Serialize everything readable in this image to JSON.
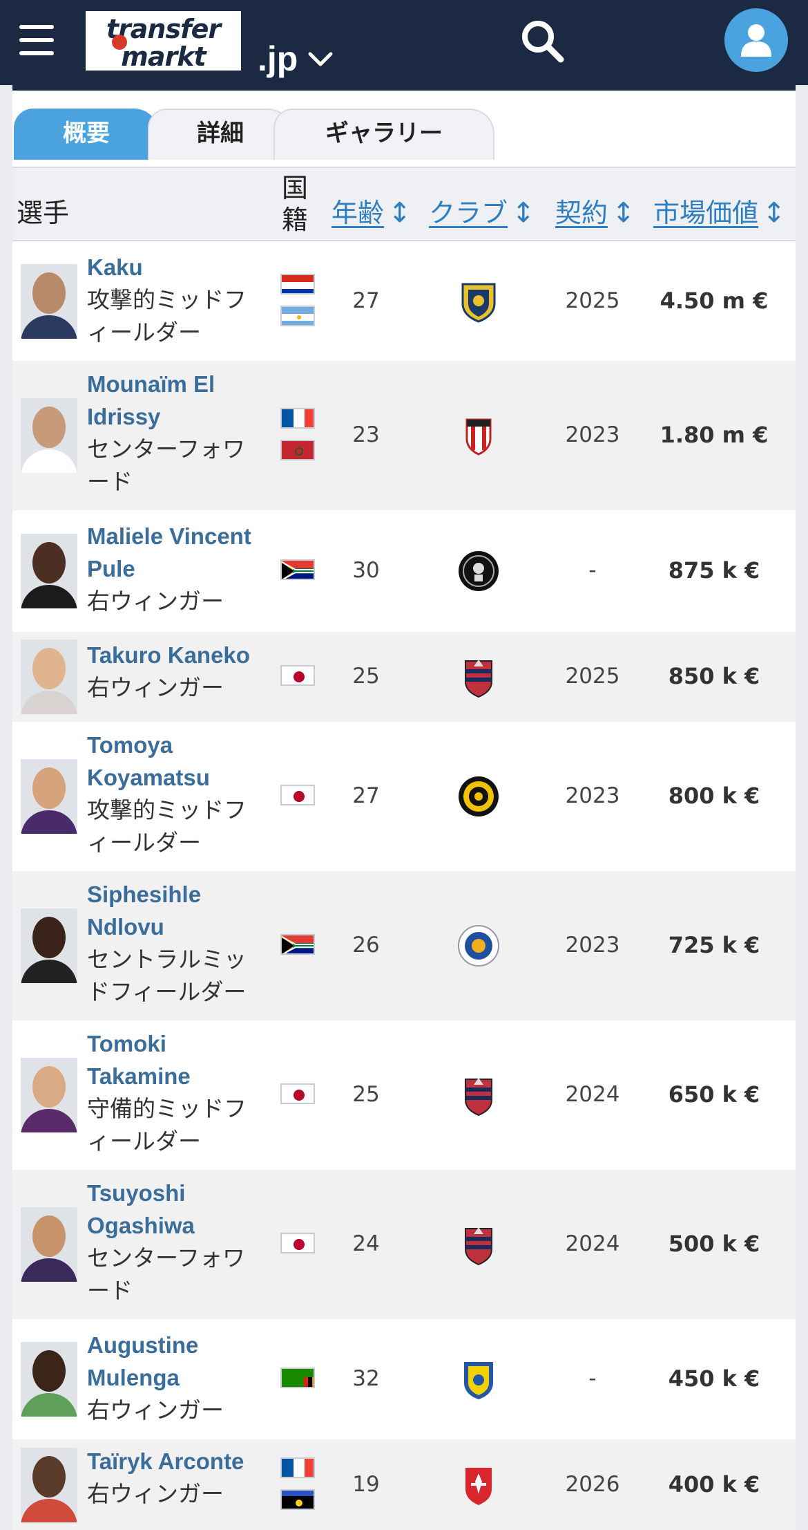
{
  "header": {
    "logo_top": "transfer",
    "logo_bottom": "markt",
    "tld": ".jp"
  },
  "tabs": [
    "概要",
    "詳細",
    "ギャラリー"
  ],
  "table": {
    "columns": {
      "player": "選手",
      "nationality": "国籍",
      "age": "年齢",
      "club": "クラブ",
      "contract": "契約",
      "market_value": "市場価値",
      "sort_glyph": "↕"
    },
    "rows": [
      {
        "name": "Kaku",
        "position": "攻撃的ミッドフィールダー",
        "flags": [
          "paraguay",
          "argentina"
        ],
        "age": "27",
        "club_icon": "crest-shield-yellow-icon",
        "contract": "2025",
        "value": "4.50 m €"
      },
      {
        "name": "Mounaïm El Idrissy",
        "position": "センターフォワード",
        "flags": [
          "france",
          "morocco"
        ],
        "age": "23",
        "club_icon": "crest-red-white-icon",
        "contract": "2023",
        "value": "1.80 m €"
      },
      {
        "name": "Maliele Vincent Pule",
        "position": "右ウィンガー",
        "flags": [
          "south-africa"
        ],
        "age": "30",
        "club_icon": "crest-black-round-icon",
        "contract": "-",
        "value": "875 k €"
      },
      {
        "name": "Takuro Kaneko",
        "position": "右ウィンガー",
        "flags": [
          "japan"
        ],
        "age": "25",
        "club_icon": "crest-consadole-icon",
        "contract": "2025",
        "value": "850 k €"
      },
      {
        "name": "Tomoya Koyamatsu",
        "position": "攻撃的ミッドフィールダー",
        "flags": [
          "japan"
        ],
        "age": "27",
        "club_icon": "crest-yellow-black-round-icon",
        "contract": "2023",
        "value": "800 k €"
      },
      {
        "name": "Siphesihle Ndlovu",
        "position": "セントラルミッドフィールダー",
        "flags": [
          "south-africa"
        ],
        "age": "26",
        "club_icon": "crest-blue-round-icon",
        "contract": "2023",
        "value": "725 k €"
      },
      {
        "name": "Tomoki Takamine",
        "position": "守備的ミッドフィールダー",
        "flags": [
          "japan"
        ],
        "age": "25",
        "club_icon": "crest-consadole-icon",
        "contract": "2024",
        "value": "650 k €"
      },
      {
        "name": "Tsuyoshi Ogashiwa",
        "position": "センターフォワード",
        "flags": [
          "japan"
        ],
        "age": "24",
        "club_icon": "crest-consadole-icon",
        "contract": "2024",
        "value": "500 k €"
      },
      {
        "name": "Augustine Mulenga",
        "position": "右ウィンガー",
        "flags": [
          "zambia"
        ],
        "age": "32",
        "club_icon": "crest-yellow-blue-icon",
        "contract": "-",
        "value": "450 k €"
      },
      {
        "name": "Taïryk Arconte",
        "position": "右ウィンガー",
        "flags": [
          "france",
          "guadeloupe"
        ],
        "age": "19",
        "club_icon": "crest-red-shield-icon",
        "contract": "2026",
        "value": "400 k €"
      }
    ]
  }
}
